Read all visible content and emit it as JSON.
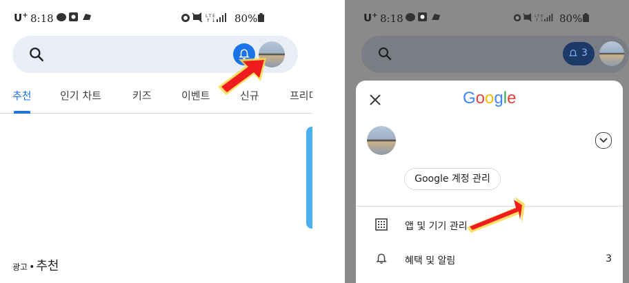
{
  "left_screen": {
    "status_bar": {
      "carrier": "U",
      "carrier_plus": "+",
      "time": "8:18",
      "battery": "80%"
    },
    "search_bar": {
      "search_icon": "search-icon",
      "notification_icon": "bell-icon",
      "avatar_icon": "avatar"
    },
    "tabs": [
      "추천",
      "인기 차트",
      "키즈",
      "이벤트",
      "신규",
      "프리미"
    ],
    "active_tab": 0,
    "ad_label": "광고",
    "separator": "•",
    "section_title": "추천"
  },
  "right_screen": {
    "status_bar": {
      "carrier": "U",
      "carrier_plus": "+",
      "time": "8:18",
      "battery": "80%"
    },
    "notification_count": "3",
    "account_sheet": {
      "close_icon": "close-icon",
      "logo": [
        "G",
        "o",
        "o",
        "g",
        "l",
        "e"
      ],
      "manage_account_button": "Google 계정 관리",
      "menu": [
        {
          "icon": "apps-grid-icon",
          "label": "앱 및 기기 관리",
          "count": ""
        },
        {
          "icon": "bell-icon",
          "label": "혜택 및 알림",
          "count": "3"
        }
      ]
    }
  },
  "colors": {
    "accent": "#1a73e8",
    "arrow_red": "#ee1c1c",
    "arrow_glow": "#ffd84a",
    "dimmed_background": "#8a8a8a",
    "logo": [
      "#4285f4",
      "#ea4335",
      "#fbbc05",
      "#4285f4",
      "#34a853",
      "#ea4335"
    ]
  }
}
